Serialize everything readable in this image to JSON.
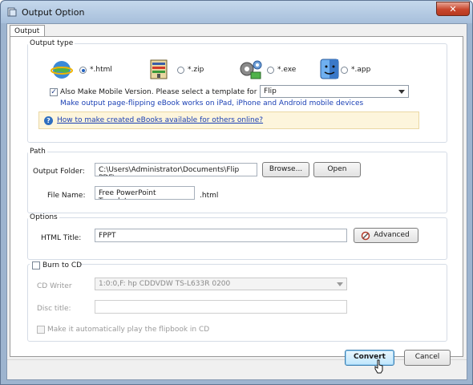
{
  "window": {
    "title": "Output Option",
    "close_label": "✕"
  },
  "tabs": [
    {
      "label": "Output"
    }
  ],
  "output_type": {
    "group_label": "Output type",
    "options": [
      {
        "label": "*.html",
        "icon": "html-globe-icon",
        "selected": true
      },
      {
        "label": "*.zip",
        "icon": "zip-archive-icon",
        "selected": false
      },
      {
        "label": "*.exe",
        "icon": "exe-program-icon",
        "selected": false
      },
      {
        "label": "*.app",
        "icon": "mac-app-icon",
        "selected": false
      }
    ],
    "mobile_checkbox_label": "Also Make Mobile Version. Please select a template for mobile:",
    "mobile_checked": true,
    "mobile_template": "Flip",
    "mobile_note": "Make output page-flipping eBook works on iPad, iPhone and Android mobile devices",
    "help_link": "How to make created eBooks available for others online?"
  },
  "path": {
    "group_label": "Path",
    "output_folder_label": "Output Folder:",
    "output_folder_value": "C:\\Users\\Administrator\\Documents\\Flip PDF\\",
    "browse_label": "Browse...",
    "open_label": "Open",
    "file_name_label": "File Name:",
    "file_name_value": "Free PowerPoint Templates",
    "file_ext": ".html"
  },
  "options": {
    "group_label": "Options",
    "html_title_label": "HTML Title:",
    "html_title_value": "FPPT",
    "advanced_label": "Advanced"
  },
  "burn": {
    "checkbox_label": "Burn to CD",
    "checked": false,
    "cd_writer_label": "CD Writer",
    "cd_writer_value": "1:0:0,F: hp       CDDVDW TS-L633R  0200",
    "disc_title_label": "Disc title:",
    "disc_title_value": "",
    "autoplay_label": "Make it automatically play the flipbook in CD",
    "autoplay_checked": false
  },
  "footer": {
    "convert_label": "Convert",
    "cancel_label": "Cancel"
  },
  "colors": {
    "accent": "#1a3fb4",
    "title_bar": "#b3c8e2",
    "close_button": "#c8462c"
  }
}
